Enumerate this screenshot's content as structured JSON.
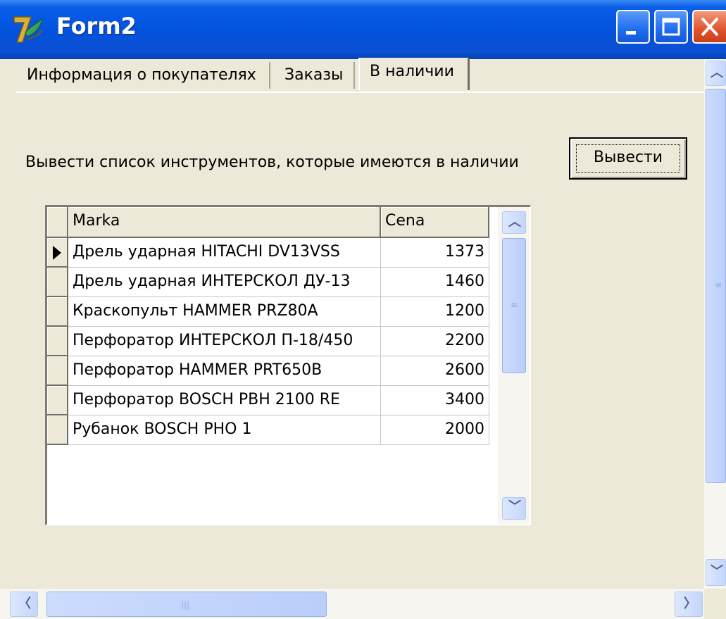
{
  "window": {
    "title": "Form2",
    "colors": {
      "face": "#ECE9D8",
      "titlebar": "#0353DD",
      "close": "#E0532C"
    }
  },
  "tabs": [
    {
      "label": "Информация о покупателях",
      "active": false
    },
    {
      "label": "Заказы",
      "active": false
    },
    {
      "label": "В наличии",
      "active": true
    }
  ],
  "content": {
    "prompt": "Вывести список инструментов, которые имеются в наличии",
    "button_label": "Вывести"
  },
  "grid": {
    "columns": [
      "Marka",
      "Cena"
    ],
    "rows": [
      {
        "marka": "Дрель ударная HITACHI DV13VSS",
        "cena": "1373",
        "current": true
      },
      {
        "marka": "Дрель ударная ИНТЕРСКОЛ ДУ-13",
        "cena": "1460"
      },
      {
        "marka": "Краскопульт HAMMER PRZ80A",
        "cena": "1200"
      },
      {
        "marka": "Перфоратор ИНТЕРСКОЛ П-18/450",
        "cena": "2200"
      },
      {
        "marka": "Перфоратор HAMMER PRT650B",
        "cena": "2600"
      },
      {
        "marka": "Перфоратор BOSCH PBH 2100 RE",
        "cena": "3400"
      },
      {
        "marka": "Рубанок BOSCH PHO 1",
        "cena": "2000"
      }
    ]
  },
  "icons": {
    "app": "delphi-app-icon",
    "minimize": "minimize-icon",
    "maximize": "maximize-icon",
    "close": "close-icon",
    "row_indicator": "current-row-arrow-icon"
  }
}
